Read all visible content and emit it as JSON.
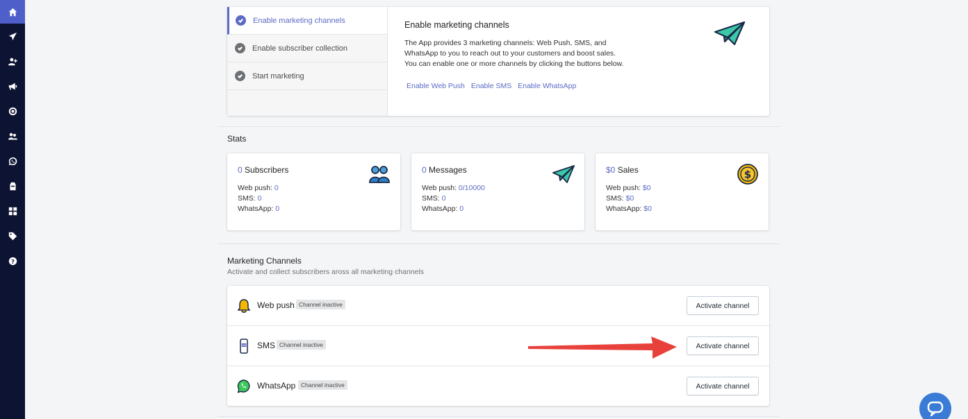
{
  "sidebar": {
    "items": [
      {
        "icon": "home-icon",
        "active": true
      },
      {
        "icon": "send-icon"
      },
      {
        "icon": "user-add-icon"
      },
      {
        "icon": "megaphone-icon"
      },
      {
        "icon": "target-icon"
      },
      {
        "icon": "users-icon"
      },
      {
        "icon": "whatsapp-icon"
      },
      {
        "icon": "store-icon"
      },
      {
        "icon": "grid-icon"
      },
      {
        "icon": "tag-icon"
      },
      {
        "icon": "help-icon"
      }
    ],
    "accent": "#4f5fc9",
    "background": "#0d1333"
  },
  "onboarding": {
    "steps": [
      {
        "label": "Enable marketing channels",
        "active": true
      },
      {
        "label": "Enable subscriber collection",
        "active": false
      },
      {
        "label": "Start marketing",
        "active": false
      }
    ],
    "title": "Enable marketing channels",
    "description_lines": [
      "The App provides 3 marketing channels: Web Push, SMS, and",
      "WhatsApp to you to reach out to your customers and boost sales.",
      "You can enable one or more channels by clicking the buttons below."
    ],
    "links": [
      "Enable Web Push",
      "Enable SMS",
      "Enable WhatsApp"
    ]
  },
  "stats": {
    "title": "Stats",
    "cards": [
      {
        "num": "0",
        "label": "Subscribers",
        "icon": "users-icon",
        "lines": [
          {
            "k": "Web push: ",
            "v": "0"
          },
          {
            "k": "SMS: ",
            "v": "0"
          },
          {
            "k": "WhatsApp: ",
            "v": "0"
          }
        ]
      },
      {
        "num": "0",
        "label": "Messages",
        "icon": "paper-plane-icon",
        "lines": [
          {
            "k": "Web push: ",
            "v": "0/10000"
          },
          {
            "k": "SMS: ",
            "v": "0"
          },
          {
            "k": "WhatsApp: ",
            "v": "0"
          }
        ]
      },
      {
        "num": "$0",
        "label": "Sales",
        "icon": "dollar-coin-icon",
        "lines": [
          {
            "k": "Web push: ",
            "v": "$0"
          },
          {
            "k": "SMS: ",
            "v": "$0"
          },
          {
            "k": "WhatsApp: ",
            "v": "$0"
          }
        ]
      }
    ]
  },
  "marketing_channels": {
    "title": "Marketing Channels",
    "subtitle": "Activate and collect subscribers aross all marketing channels",
    "rows": [
      {
        "name": "Web push",
        "badge": "Channel inactive",
        "button": "Activate channel",
        "icon": "bell-icon"
      },
      {
        "name": "SMS",
        "badge": "Channel inactive",
        "button": "Activate channel",
        "icon": "phone-sms-icon"
      },
      {
        "name": "WhatsApp",
        "badge": "Channel inactive",
        "button": "Activate channel",
        "icon": "whatsapp-icon"
      }
    ]
  },
  "colors": {
    "accent": "#5c6ac4",
    "arrow": "#e8413b",
    "chat": "#3a7bd5"
  }
}
